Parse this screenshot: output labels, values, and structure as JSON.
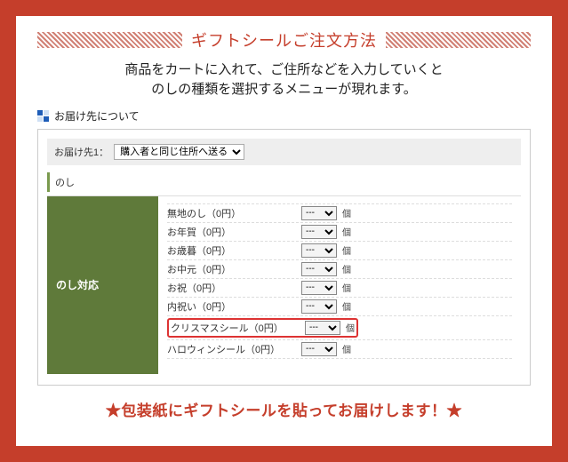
{
  "title": "ギフトシールご注文方法",
  "intro_line1": "商品をカートに入れて、ご住所などを入力していくと",
  "intro_line2": "のしの種類を選択するメニューが現れます。",
  "section_header": "お届け先について",
  "address": {
    "label": "お届け先1：",
    "selected": "購入者と同じ住所へ送る"
  },
  "noshi_header": "のし",
  "green_label": "のし対応",
  "select_placeholder": "---",
  "unit": "個",
  "options": [
    {
      "label": "無地のし（0円）",
      "highlight": false
    },
    {
      "label": "お年賀（0円）",
      "highlight": false
    },
    {
      "label": "お歳暮（0円）",
      "highlight": false
    },
    {
      "label": "お中元（0円）",
      "highlight": false
    },
    {
      "label": "お祝（0円）",
      "highlight": false
    },
    {
      "label": "内祝い（0円）",
      "highlight": false
    },
    {
      "label": "クリスマスシール（0円）",
      "highlight": true
    },
    {
      "label": "ハロウィンシール（0円）",
      "highlight": false
    }
  ],
  "footer": "★包装紙にギフトシールを貼ってお届けします！★"
}
